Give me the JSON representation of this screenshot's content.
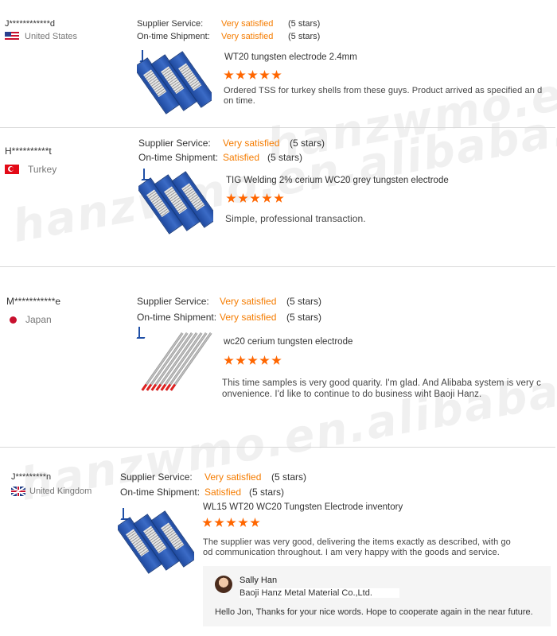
{
  "reviews": [
    {
      "buyer": "J************d",
      "country": "United States",
      "flag": "us-flag",
      "supplier_service": {
        "label": "Supplier Service:",
        "value": "Very satisfied",
        "stars": "(5 stars)"
      },
      "shipment": {
        "label": "On-time Shipment:",
        "value": "Very satisfied",
        "stars": "(5 stars)"
      },
      "product": "WT20 tungsten electrode 2.4mm",
      "rating": 5,
      "comment": "Ordered TSS for turkey shells from these guys. Product arrived as specified an d on time."
    },
    {
      "buyer": "H**********t",
      "country": "Turkey",
      "flag": "tr-flag",
      "supplier_service": {
        "label": "Supplier Service:",
        "value": "Very satisfied",
        "stars": "(5 stars)"
      },
      "shipment": {
        "label": "On-time Shipment:",
        "value": "Satisfied",
        "stars": "(5 stars)"
      },
      "product": "TIG Welding 2% cerium WC20 grey tungsten electrode",
      "rating": 5,
      "comment": "Simple, professional transaction."
    },
    {
      "buyer": "M***********e",
      "country": "Japan",
      "flag": "jp-flag",
      "supplier_service": {
        "label": "Supplier Service:",
        "value": "Very satisfied",
        "stars": "(5 stars)"
      },
      "shipment": {
        "label": "On-time Shipment:",
        "value": "Very satisfied",
        "stars": "(5 stars)"
      },
      "product": "wc20 cerium tungsten electrode",
      "rating": 5,
      "comment": "This time samples is very good quarity. I'm glad. And Alibaba system is very c onvenience. I'd like to continue to do business wiht Baoji Hanz."
    },
    {
      "buyer": "J*********n",
      "country": "United Kingdom",
      "flag": "uk-flag",
      "supplier_service": {
        "label": "Supplier Service:",
        "value": "Very satisfied",
        "stars": "(5 stars)"
      },
      "shipment": {
        "label": "On-time Shipment:",
        "value": "Satisfied",
        "stars": "(5 stars)"
      },
      "product": "WL15 WT20 WC20 Tungsten Electrode inventory",
      "rating": 5,
      "comment": "The supplier was very good, delivering the items exactly as described, with go od communication throughout. I am very happy with the goods and service."
    }
  ],
  "reply": {
    "name": "Sally Han",
    "company": "Baoji Hanz Metal Material Co.,Ltd.",
    "text": "Hello Jon, Thanks for your nice words. Hope to cooperate again in the near future."
  },
  "watermarks": [
    "hanzwmo.en.alibaba.com",
    "hanzwmo.en.alibaba.com",
    "hanzwmo.en.alibaba.com"
  ],
  "colors": {
    "accent": "#f57c00",
    "star": "#ff6600",
    "divider": "#d9d9d9"
  }
}
